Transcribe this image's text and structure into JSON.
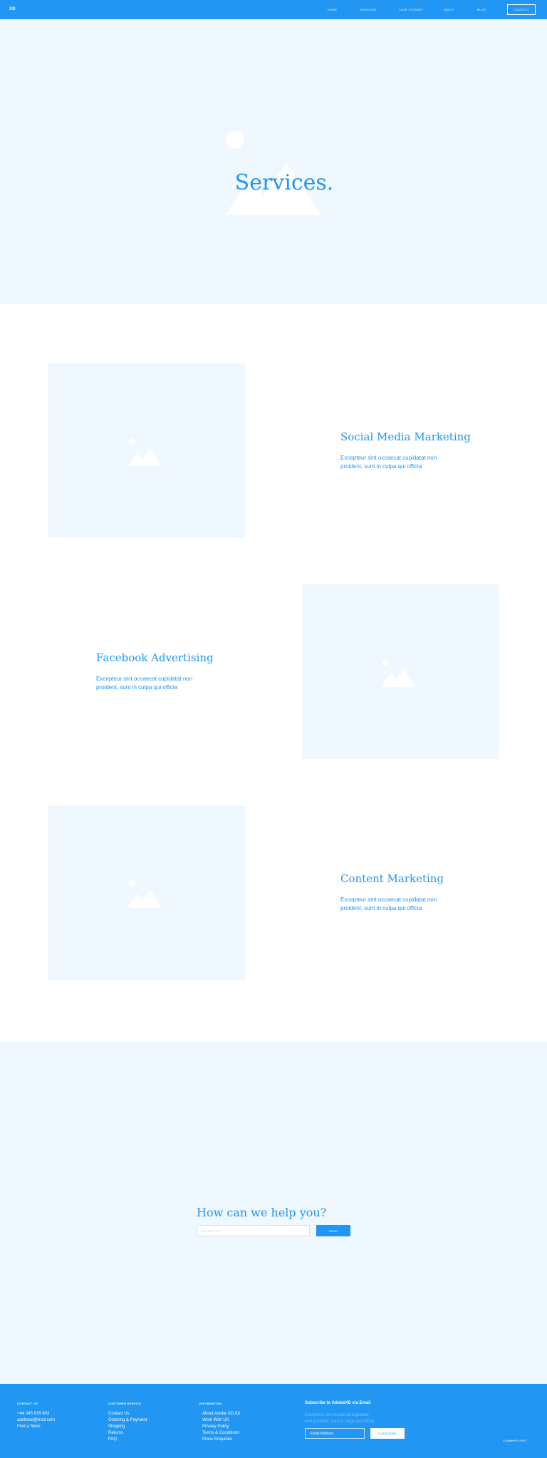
{
  "header": {
    "logo": "XD",
    "nav": [
      {
        "label": "HOME"
      },
      {
        "label": "SERVICES"
      },
      {
        "label": "CASE STORIES"
      },
      {
        "label": "ABOUT"
      },
      {
        "label": "BLOG"
      }
    ],
    "contact_label": "CONTACT"
  },
  "hero": {
    "title": "Services."
  },
  "services": [
    {
      "title": "Social Media Marketing",
      "text": "Excepteur sint occaecat cupidatat non proident, sunt in culpa qui officia",
      "icon": "image-placeholder-icon"
    },
    {
      "title": "Facebook Advertising",
      "text": "Excepteur sint occaecat cupidatat non proident, sunt in culpa qui officia",
      "icon": "image-placeholder-icon"
    },
    {
      "title": "Content Marketing",
      "text": "Excepteur sint occaecat cupidatat non proident, sunt in culpa qui officia",
      "icon": "image-placeholder-icon"
    }
  ],
  "help": {
    "title": "How can we help you?",
    "input_placeholder": "Required Field",
    "send_label": "SEND"
  },
  "footer": {
    "columns": [
      {
        "heading": "CONTACT US",
        "links": [
          "+44 345 678 903",
          "adobexd@mail.com",
          "Find a Store"
        ]
      },
      {
        "heading": "CUSTOMER SERVICE",
        "links": [
          "Contact Us",
          "Ordering & Payment",
          "Shipping",
          "Returns",
          "FAQ"
        ]
      },
      {
        "heading": "INFORMATION",
        "links": [
          "About Adobe XD Kit",
          "Work With US",
          "Privacy Policy",
          "Terms & Conditions",
          "Press Enquiries"
        ]
      }
    ],
    "subscribe": {
      "heading": "Subscribe to AdobeXD via Email",
      "text": "Excepteur sint occaecat cupidatat non proident, sunt in culpa qui officia",
      "input_placeholder": "Email Address",
      "button_label": "SUBSCRIBE"
    },
    "copyright": "© AdobeXD UI KIT"
  },
  "colors": {
    "brand": "#2196f3",
    "light_bg": "#eff7ff",
    "white": "#ffffff"
  }
}
